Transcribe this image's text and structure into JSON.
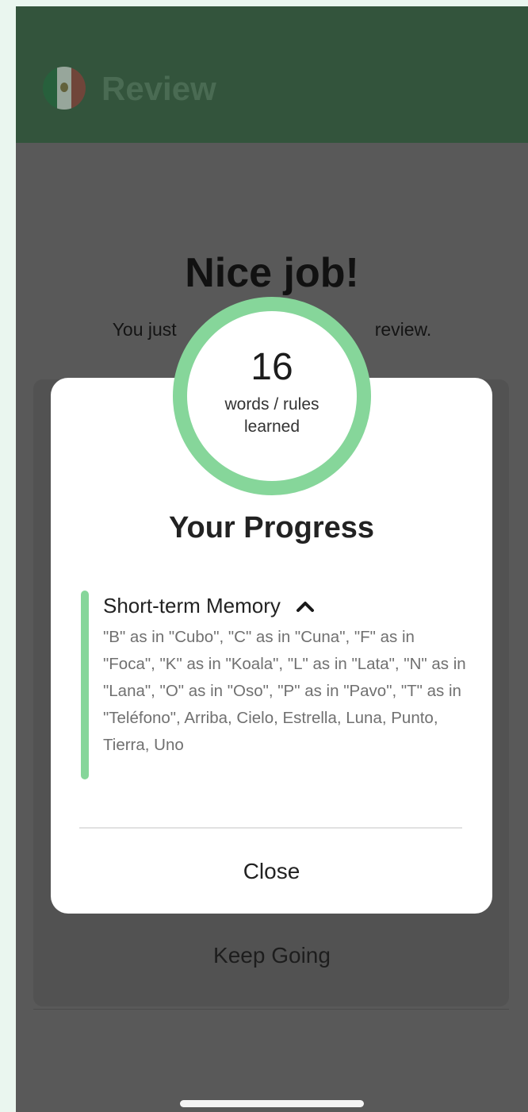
{
  "header": {
    "title": "Review",
    "flag_icon": "mexico-flag-icon",
    "bar_color": "#33543c"
  },
  "main": {
    "heading": "Nice job!",
    "subtitle_start": "You just",
    "subtitle_end": "review.",
    "keep_going_label": "Keep Going"
  },
  "badge": {
    "count": "16",
    "label": "words / rules learned",
    "ring_color": "#86d69a"
  },
  "modal": {
    "title": "Your Progress",
    "section_title": "Short-term Memory",
    "section_icon": "chevron-up-icon",
    "section_text": "\"B\" as in \"Cubo\", \"C\" as in \"Cuna\", \"F\" as in \"Foca\", \"K\" as in \"Koala\", \"L\" as in \"Lata\", \"N\" as in \"Lana\", \"O\" as in \"Oso\", \"P\" as in \"Pavo\", \"T\" as in \"Teléfono\", Arriba, Cielo, Estrella, Luna, Punto, Tierra, Uno",
    "close_label": "Close"
  }
}
